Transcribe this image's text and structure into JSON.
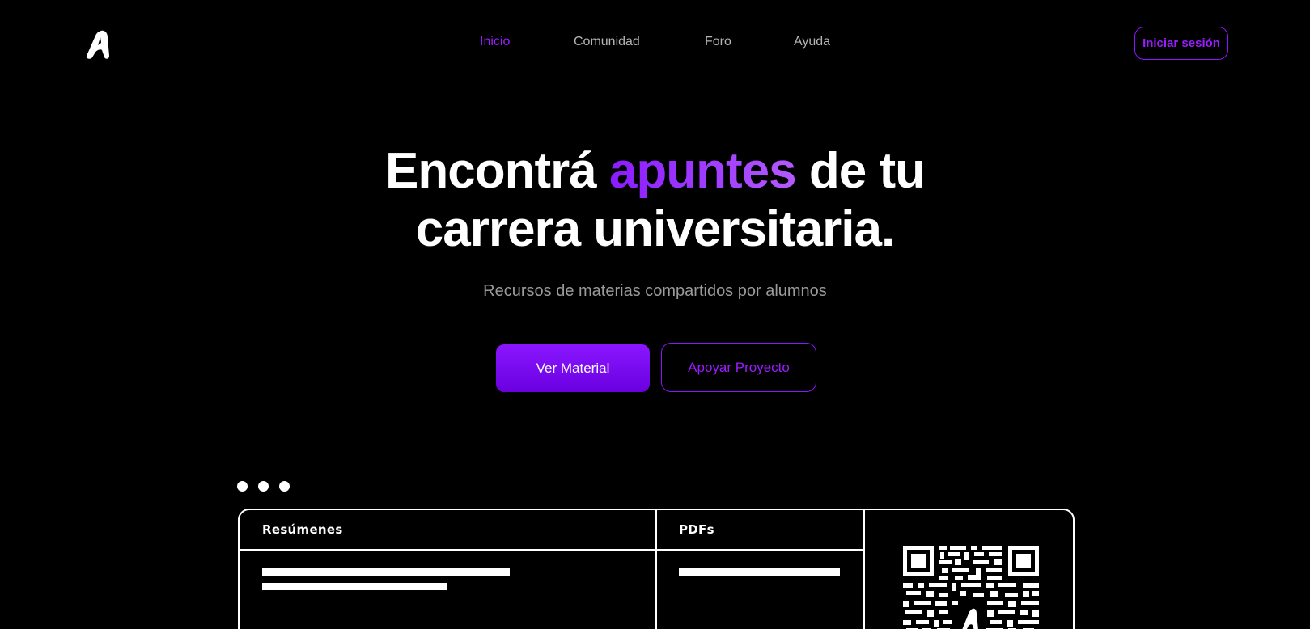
{
  "header": {
    "logo_icon": "a-logo-icon",
    "nav": [
      {
        "label": "Inicio",
        "active": true
      },
      {
        "label": "Comunidad",
        "active": false
      },
      {
        "label": "Foro",
        "active": false
      },
      {
        "label": "Ayuda",
        "active": false
      }
    ],
    "login_label": "Iniciar sesión"
  },
  "hero": {
    "title_part1": "Encontrá ",
    "title_accent": "apuntes",
    "title_part2": " de tu",
    "title_line2": "carrera universitaria.",
    "subtitle": "Recursos de materias compartidos por alumnos",
    "primary_button": "Ver Material",
    "secondary_button": "Apoyar Proyecto"
  },
  "preview": {
    "col1_title": "Resúmenes",
    "col2_title": "PDFs",
    "qr_icon": "qr-code-icon"
  },
  "colors": {
    "background": "#000000",
    "accent": "#8a15ff",
    "text": "#ffffff",
    "muted": "#9a9a9a"
  }
}
